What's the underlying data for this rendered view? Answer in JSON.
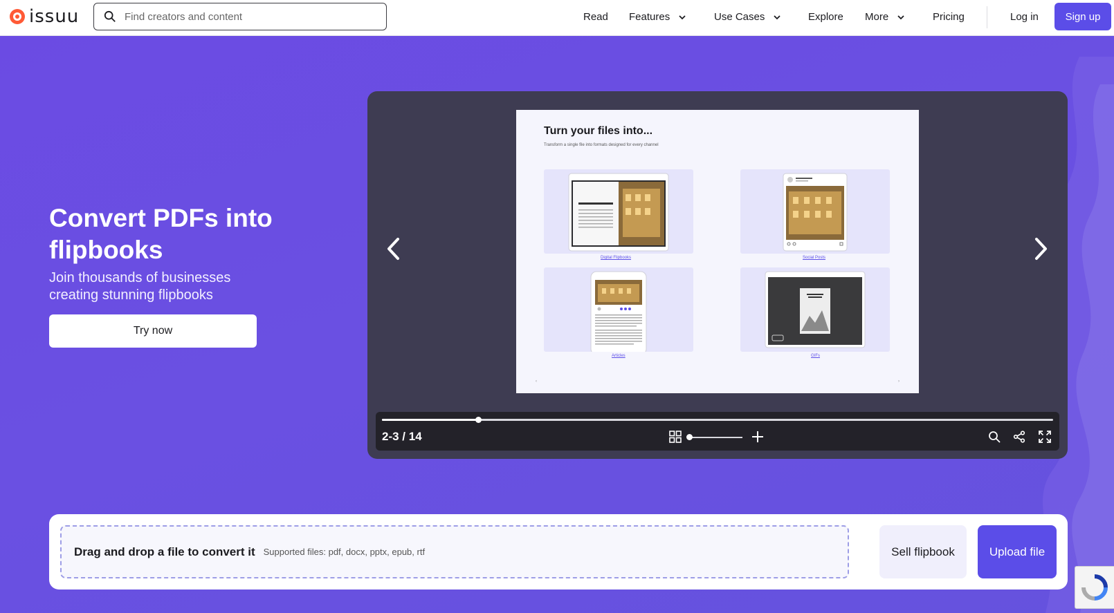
{
  "header": {
    "logo_text": "issuu",
    "search_placeholder": "Find creators and content",
    "nav": {
      "read": "Read",
      "features": "Features",
      "use_cases": "Use Cases",
      "explore": "Explore",
      "more": "More",
      "pricing": "Pricing",
      "login": "Log in",
      "signup": "Sign up"
    }
  },
  "hero": {
    "title": "Convert PDFs into flipbooks",
    "subtitle": "Join thousands of businesses creating stunning flipbooks",
    "cta": "Try now"
  },
  "viewer": {
    "page_title": "Turn your files into...",
    "page_subtitle": "Transform a single file into formats designed for every channel",
    "cards": [
      {
        "label": "Digital Flipbooks"
      },
      {
        "label": "Social Posts"
      },
      {
        "label": "Articles"
      },
      {
        "label": "GIFs"
      }
    ],
    "page_count": "2-3 / 14",
    "progress": 0.143,
    "zoom_level": 0.0
  },
  "upload": {
    "drop_title": "Drag and drop a file to convert it",
    "supported": "Supported files: pdf, docx, pptx, epub, rtf",
    "sell_label": "Sell flipbook",
    "upload_label": "Upload file"
  },
  "colors": {
    "brand": "#5b4de8",
    "logo": "#ff5a36",
    "hero_bg": "#6a4fe0"
  }
}
